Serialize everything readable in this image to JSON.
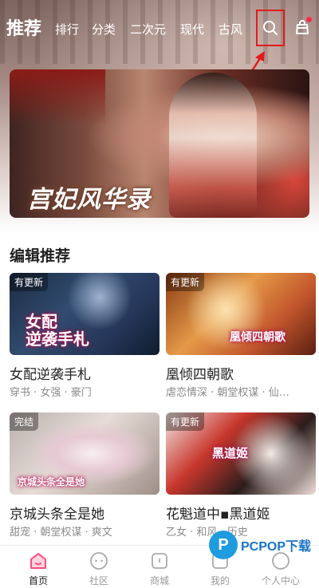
{
  "nav": {
    "tabs": [
      {
        "label": "推荐",
        "active": true
      },
      {
        "label": "排行"
      },
      {
        "label": "分类"
      },
      {
        "label": "二次元"
      },
      {
        "label": "现代"
      },
      {
        "label": "古风"
      }
    ],
    "search_icon": "search-icon",
    "bag_icon": "shopping-bag-icon"
  },
  "banner": {
    "title": "宫妃风华录"
  },
  "section": {
    "title": "编辑推荐"
  },
  "cards": [
    {
      "title": "女配逆袭手札",
      "tags": "穿书 · 女强 · 豪门",
      "badge": "有更新",
      "cover_text": "女配\n逆袭手札"
    },
    {
      "title": "凰倾四朝歌",
      "tags": "虐恋情深 · 朝堂权谋 · 仙…",
      "badge": "有更新",
      "cover_text": "凰倾四朝歌"
    },
    {
      "title": "京城头条全是她",
      "tags": "甜宠 · 朝堂权谋 · 爽文",
      "badge": "完结",
      "cover_text": "京城头条全是她"
    },
    {
      "title": "花魁道中▪黑道姬",
      "tags": "乙女 · 和风 · 历史",
      "badge": "有更新",
      "cover_text": "黑道姬"
    }
  ],
  "bottom_nav": [
    {
      "label": "首页",
      "icon": "home-icon",
      "active": true
    },
    {
      "label": "社区",
      "icon": "community-icon"
    },
    {
      "label": "商城",
      "icon": "store-icon"
    },
    {
      "label": "我的",
      "icon": "my-icon"
    },
    {
      "label": "个人中心",
      "icon": "profile-icon"
    }
  ],
  "watermark": {
    "logo_letter": "P",
    "text": "PCPOP下载"
  },
  "colors": {
    "highlight_box": "#e31b1b",
    "notification_dot": "#ff2b4e",
    "home_active": "#ff4d7d"
  }
}
